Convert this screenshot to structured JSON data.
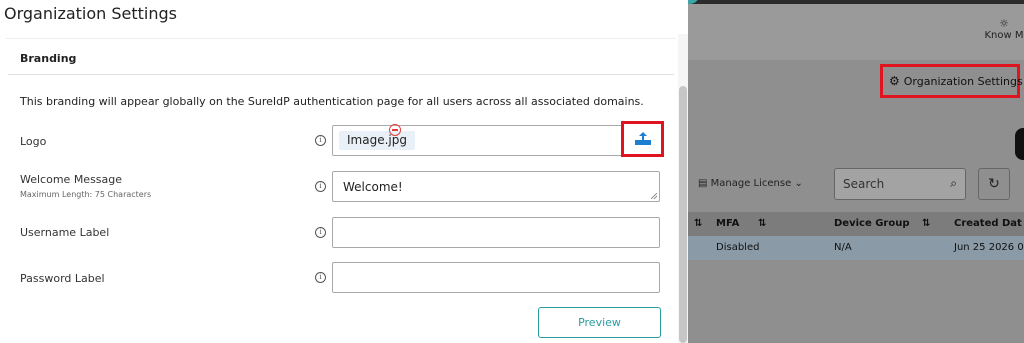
{
  "modal": {
    "title": "Organization Settings",
    "section_title": "Branding",
    "description": "This branding will appear globally on the SureIdP authentication page for all users across all associated domains.",
    "fields": {
      "logo": {
        "label": "Logo",
        "file_name": "Image.jpg"
      },
      "welcome": {
        "label": "Welcome Message",
        "sublabel": "Maximum Length: 75 Characters",
        "value": "Welcome!"
      },
      "username": {
        "label": "Username Label",
        "value": ""
      },
      "password": {
        "label": "Password Label",
        "value": ""
      }
    },
    "preview_label": "Preview"
  },
  "background": {
    "know_more": "Know M",
    "org_settings_label": "Organization Settings",
    "manage_license_label": "Manage License",
    "search_placeholder": "Search",
    "columns": [
      "MFA",
      "Device Group",
      "Created Dat"
    ],
    "row": [
      "Disabled",
      "N/A",
      "Jun 25 2026 0"
    ]
  },
  "colors": {
    "accent": "#2a9b9e",
    "highlight": "#e0141f",
    "upload_icon": "#1d7fd1",
    "remove_icon": "#e43b3b"
  }
}
